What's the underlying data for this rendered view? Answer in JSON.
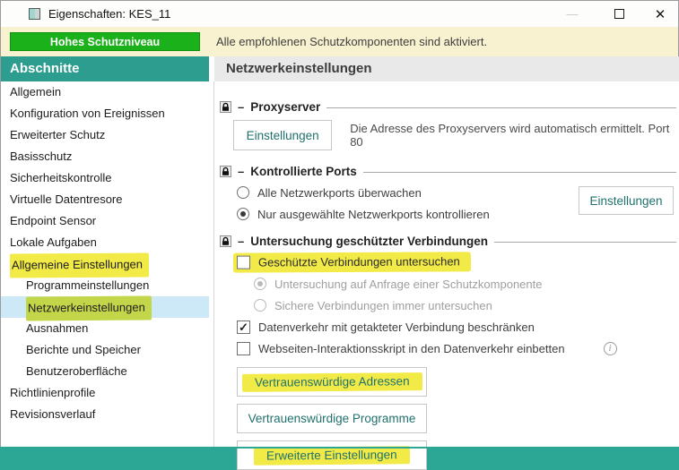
{
  "window": {
    "title": "Eigenschaften: KES_11",
    "controls": {
      "minimize": "—",
      "close": "✕"
    }
  },
  "banner": {
    "status_label": "Hohes Schutzniveau",
    "message": "Alle empfohlenen Schutzkomponenten sind aktiviert."
  },
  "sidebar": {
    "header": "Abschnitte",
    "items": [
      {
        "label": "Allgemein"
      },
      {
        "label": "Konfiguration von Ereignissen"
      },
      {
        "label": "Erweiterter Schutz"
      },
      {
        "label": "Basisschutz"
      },
      {
        "label": "Sicherheitskontrolle"
      },
      {
        "label": "Virtuelle Datentresore"
      },
      {
        "label": "Endpoint Sensor"
      },
      {
        "label": "Lokale Aufgaben"
      },
      {
        "label": "Allgemeine Einstellungen",
        "highlighted": true
      },
      {
        "label": "Programmeinstellungen",
        "indent": 1
      },
      {
        "label": "Netzwerkeinstellungen",
        "indent": 1,
        "selected": true,
        "highlighted": true
      },
      {
        "label": "Ausnahmen",
        "indent": 1
      },
      {
        "label": "Berichte und Speicher",
        "indent": 1
      },
      {
        "label": "Benutzeroberfläche",
        "indent": 1
      },
      {
        "label": "Richtlinienprofile"
      },
      {
        "label": "Revisionsverlauf"
      }
    ]
  },
  "main": {
    "title": "Netzwerkeinstellungen",
    "proxy": {
      "title": "Proxyserver",
      "settings_button": "Einstellungen",
      "description": "Die Adresse des Proxyservers wird automatisch ermittelt. Port 80"
    },
    "ports": {
      "title": "Kontrollierte Ports",
      "option_all": "Alle Netzwerkports überwachen",
      "option_selected_only": "Nur ausgewählte Netzwerkports kontrollieren",
      "settings_button": "Einstellungen"
    },
    "secure_connections": {
      "title": "Untersuchung geschützter Verbindungen",
      "scan_checkbox": "Geschützte Verbindungen untersuchen",
      "option_on_request": "Untersuchung auf Anfrage einer Schutzkomponente",
      "option_always": "Sichere Verbindungen immer untersuchen",
      "metered_checkbox": "Datenverkehr mit getakteter Verbindung beschränken",
      "script_checkbox": "Webseiten-Interaktionsskript in den Datenverkehr einbetten",
      "trusted_addresses_button": "Vertrauenswürdige Adressen",
      "trusted_programs_button": "Vertrauenswürdige Programme",
      "advanced_button": "Erweiterte Einstellungen"
    }
  },
  "glyphs": {
    "collapse": "–",
    "check": "✓",
    "info": "i"
  },
  "colors": {
    "accent": "#2d9d90",
    "banner": "#f8f2d0",
    "green": "#1bb11b",
    "highlight": "#f2ea47",
    "selected": "#cde9f7",
    "btn-text": "#20716d"
  }
}
